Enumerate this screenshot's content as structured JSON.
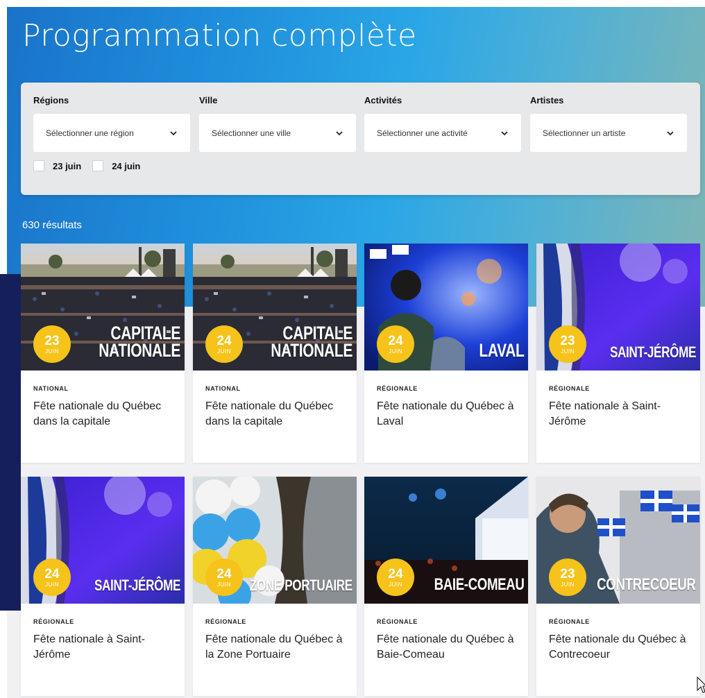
{
  "page": {
    "title": "Programmation complète"
  },
  "filters": {
    "regions": {
      "label": "Régions",
      "placeholder": "Sélectionner une région"
    },
    "ville": {
      "label": "Ville",
      "placeholder": "Sélectionner une ville"
    },
    "activites": {
      "label": "Activités",
      "placeholder": "Sélectionner une activité"
    },
    "artistes": {
      "label": "Artistes",
      "placeholder": "Sélectionner un artiste"
    },
    "dates": [
      {
        "label": "23 juin",
        "checked": false
      },
      {
        "label": "24 juin",
        "checked": false
      }
    ]
  },
  "results": {
    "count_label": "630 résultats",
    "cards": [
      {
        "day": "23",
        "month": "JUIN",
        "place": [
          "CAPITALE",
          "NATIONALE"
        ],
        "type": "NATIONAL",
        "title": "Fête nationale du Québec dans la capitale",
        "image": "crowd-concert"
      },
      {
        "day": "24",
        "month": "JUIN",
        "place": [
          "CAPITALE",
          "NATIONALE"
        ],
        "type": "NATIONAL",
        "title": "Fête nationale du Québec dans la capitale",
        "image": "crowd-concert"
      },
      {
        "day": "24",
        "month": "JUIN",
        "place": [
          "LAVAL"
        ],
        "type": "RÉGIONALE",
        "title": "Fête nationale du Québec à Laval",
        "image": "blue-stage"
      },
      {
        "day": "23",
        "month": "JUIN",
        "place": [
          "SAINT-JÉRÔME"
        ],
        "type": "RÉGIONALE",
        "title": "Fête nationale à Saint-Jérôme",
        "image": "flag-purple"
      },
      {
        "day": "24",
        "month": "JUIN",
        "place": [
          "SAINT-JÉRÔME"
        ],
        "type": "RÉGIONALE",
        "title": "Fête nationale à Saint-Jérôme",
        "image": "flag-purple"
      },
      {
        "day": "24",
        "month": "JUIN",
        "place": [
          "ZONE PORTUAIRE"
        ],
        "type": "RÉGIONALE",
        "title": "Fête nationale du Québec à la Zone Portuaire",
        "image": "balloons"
      },
      {
        "day": "24",
        "month": "JUIN",
        "place": [
          "BAIE-COMEAU"
        ],
        "type": "RÉGIONALE",
        "title": "Fête nationale du Québec à Baie-Comeau",
        "image": "night-stage"
      },
      {
        "day": "23",
        "month": "JUIN",
        "place": [
          "CONTRECOEUR"
        ],
        "type": "RÉGIONALE",
        "title": "Fête nationale du Québec à Contrecoeur",
        "image": "boy-flags"
      }
    ]
  },
  "colors": {
    "badge": "#f6c31a",
    "hero_start": "#1a73c9",
    "hero_end": "#7fb5b4",
    "navy": "#15205a"
  }
}
